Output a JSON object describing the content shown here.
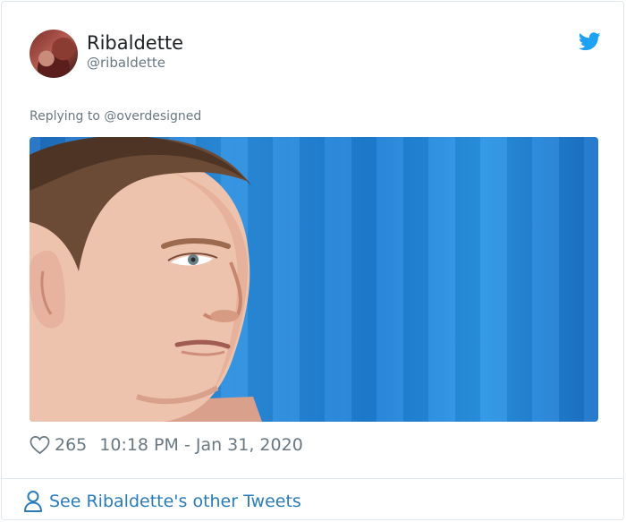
{
  "tweet": {
    "author": {
      "display_name": "Ribaldette",
      "handle": "@ribaldette"
    },
    "replying_to_prefix": "Replying to",
    "replying_to_mention": "@overdesigned",
    "likes": "265",
    "timestamp": "10:18 PM - Jan 31, 2020",
    "footer_link": "See Ribaldette's other Tweets"
  },
  "icons": {
    "brand": "twitter-bird-icon",
    "like": "heart-icon",
    "profile": "person-icon"
  },
  "colors": {
    "twitter_blue": "#1da1f2",
    "link_blue": "#2b7bb9",
    "muted_text": "#697882",
    "border": "#e1e8ed"
  }
}
